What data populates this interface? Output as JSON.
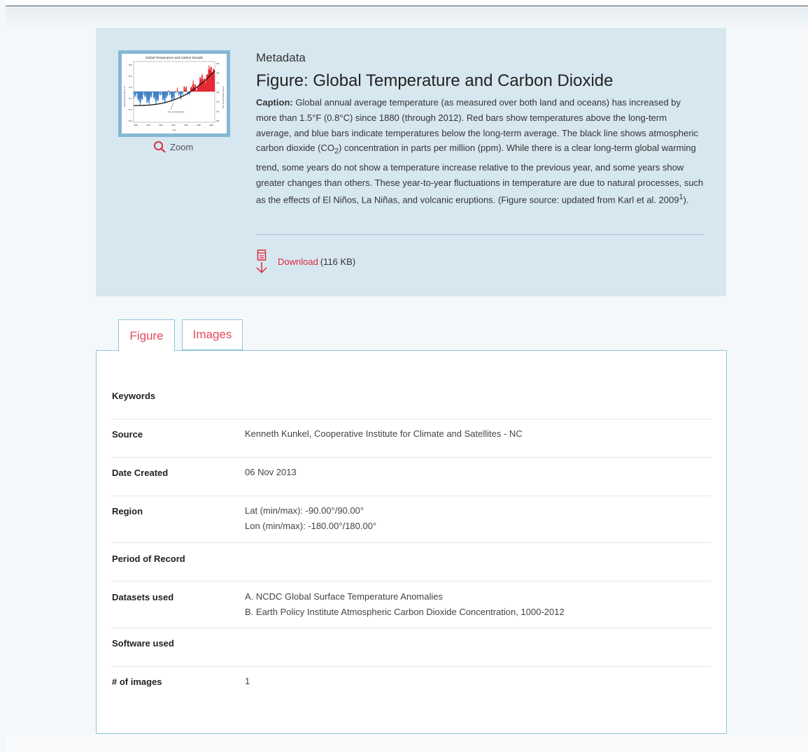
{
  "metadata_panel": {
    "section_label": "Metadata",
    "title": "Figure: Global Temperature and Carbon Dioxide",
    "caption_label": "Caption:",
    "caption_part1": "Global annual average temperature (as measured over both land and oceans) has increased by more than 1.5°F (0.8°C) since 1880 (through 2012). Red bars show temperatures above the long-term average, and blue bars indicate temperatures below the long-term average. The black line shows atmospheric carbon dioxide (CO",
    "caption_sub": "2",
    "caption_part2": ") concentration in parts per million (ppm). While there is a clear long-term global warming trend, some years do not show a temperature increase relative to the previous year, and some years show greater changes than others. These year-to-year fluctuations in temperature are due to natural processes, such as the effects of El Niños, La Niñas, and volcanic eruptions. (Figure source: updated from Karl et al. 2009",
    "caption_sup": "1",
    "caption_part3": ").",
    "zoom_label": "Zoom",
    "download_label": "Download",
    "download_size": "(116 KB)"
  },
  "thumbnail": {
    "title": "Global Temperature and Carbon Dioxide",
    "co2_label": "CO₂ Concentration",
    "x_ticks": [
      "1880",
      "1900",
      "1920",
      "1940",
      "1960",
      "1980",
      "2000"
    ],
    "x_label": "Year",
    "y_left_ticks": [
      "58.6",
      "58.2",
      "57.8",
      "57.4",
      "57.0",
      "56.6"
    ],
    "y_left_label": "Global Temperature (°F)",
    "y_right_ticks": [
      "400",
      "380",
      "360",
      "340",
      "320",
      "300",
      "280"
    ],
    "y_right_label": "CO₂ Concentration (ppm)"
  },
  "tabs": [
    {
      "label": "Figure",
      "active": true
    },
    {
      "label": "Images",
      "active": false
    }
  ],
  "details": {
    "keywords": {
      "label": "Keywords",
      "value": ""
    },
    "source": {
      "label": "Source",
      "value": "Kenneth Kunkel, Cooperative Institute for Climate and Satellites - NC"
    },
    "date_created": {
      "label": "Date Created",
      "value": "06 Nov 2013"
    },
    "region": {
      "label": "Region",
      "line1": "Lat (min/max): -90.00°/90.00°",
      "line2": "Lon (min/max): -180.00°/180.00°"
    },
    "period": {
      "label": "Period of Record",
      "value": ""
    },
    "datasets": {
      "label": "Datasets used",
      "item1": "A.  NCDC Global Surface Temperature Anomalies",
      "item2": "B.  Earth Policy Institute Atmospheric Carbon Dioxide Concentration, 1000-2012"
    },
    "software": {
      "label": "Software used",
      "value": ""
    },
    "num_images": {
      "label": "# of images",
      "value": "1"
    }
  },
  "colors": {
    "accent_red": "#e0273b",
    "panel_blue": "#d7e7f0",
    "tab_border": "#8fc6d9",
    "warm_bar": "#e8212e",
    "cool_bar": "#3a7ec2"
  },
  "icons": {
    "zoom": "magnifier-icon",
    "download": "download-icon"
  }
}
